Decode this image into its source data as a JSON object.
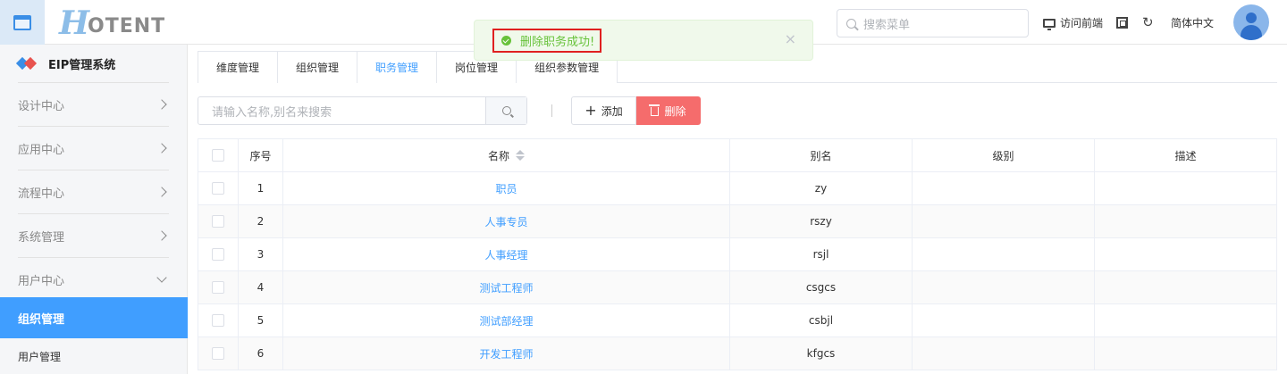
{
  "header": {
    "logo_h": "H",
    "logo_rest": "OTENT",
    "search_placeholder": "搜索菜单",
    "visit_frontend": "访问前端",
    "language": "简体中文"
  },
  "sidebar": {
    "system_title": "EIP管理系统",
    "items": [
      {
        "label": "设计中心"
      },
      {
        "label": "应用中心"
      },
      {
        "label": "流程中心"
      },
      {
        "label": "系统管理"
      },
      {
        "label": "用户中心"
      }
    ],
    "active_item": "组织管理",
    "sub_item": "用户管理"
  },
  "tabs": [
    {
      "label": "维度管理"
    },
    {
      "label": "组织管理"
    },
    {
      "label": "职务管理"
    },
    {
      "label": "岗位管理"
    },
    {
      "label": "组织参数管理"
    }
  ],
  "active_tab": "职务管理",
  "toolbar": {
    "search_placeholder": "请输入名称,别名来搜索",
    "add_label": "添加",
    "delete_label": "删除"
  },
  "table": {
    "columns": [
      "序号",
      "名称",
      "别名",
      "级别",
      "描述"
    ],
    "rows": [
      {
        "index": "1",
        "name": "职员",
        "alias": "zy",
        "level": "",
        "desc": ""
      },
      {
        "index": "2",
        "name": "人事专员",
        "alias": "rszy",
        "level": "",
        "desc": ""
      },
      {
        "index": "3",
        "name": "人事经理",
        "alias": "rsjl",
        "level": "",
        "desc": ""
      },
      {
        "index": "4",
        "name": "测试工程师",
        "alias": "csgcs",
        "level": "",
        "desc": ""
      },
      {
        "index": "5",
        "name": "测试部经理",
        "alias": "csbjl",
        "level": "",
        "desc": ""
      },
      {
        "index": "6",
        "name": "开发工程师",
        "alias": "kfgcs",
        "level": "",
        "desc": ""
      }
    ]
  },
  "toast": {
    "message": "删除职务成功!",
    "close_symbol": "×"
  },
  "icons": {
    "refresh": "↻"
  },
  "colors": {
    "primary": "#409eff",
    "danger": "#f56c6c",
    "success": "#67c23a",
    "highlight_border": "#e02020"
  }
}
